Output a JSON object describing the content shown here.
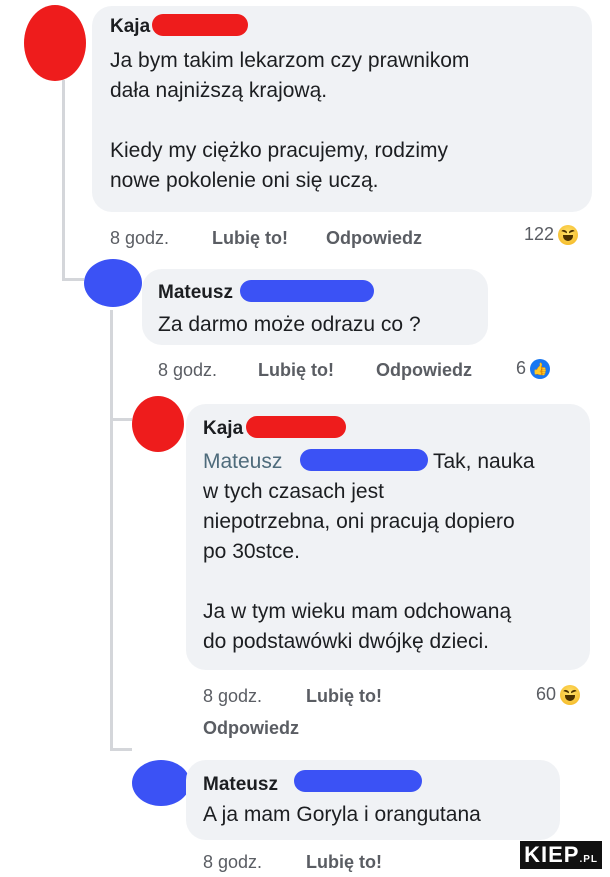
{
  "comments": [
    {
      "author": "Kaja",
      "text": "Ja bym takim lekarzom czy prawnikom\ndała najniższą krajową.\n\nKiedy my ciężko pracujemy, rodzimy\nnowe pokolenie oni się uczą.",
      "time": "8 godz.",
      "like": "Lubię to!",
      "reply": "Odpowiedz",
      "reaction_count": "122",
      "reaction_icon": "haha-emoji-icon"
    },
    {
      "author": "Mateusz",
      "text": "Za darmo może odrazu co ?",
      "time": "8 godz.",
      "like": "Lubię to!",
      "reply": "Odpowiedz",
      "reaction_count": "6",
      "reaction_icon": "like-icon"
    },
    {
      "author": "Kaja",
      "mention": "Mateusz",
      "text_first": "Tak, nauka",
      "text": "w tych czasach jest\nniepotrzebna, oni pracują dopiero\npo 30stce.\n\nJa w tym wieku mam odchowaną\ndo podstawówki dwójkę dzieci.",
      "time": "8 godz.",
      "like": "Lubię to!",
      "reply": "Odpowiedz",
      "reaction_count": "60",
      "reaction_icon": "haha-emoji-icon"
    },
    {
      "author": "Mateusz",
      "text": "A ja mam Goryla i orangutana",
      "time": "8 godz.",
      "like": "Lubię to!"
    }
  ],
  "watermark": {
    "main": "KIEP",
    "suffix": ".PL"
  },
  "colors": {
    "bubble": "#f0f2f5",
    "redaction_red": "#ee1c1c",
    "redaction_blue": "#3b52f5",
    "mention": "#4e6b7b"
  }
}
